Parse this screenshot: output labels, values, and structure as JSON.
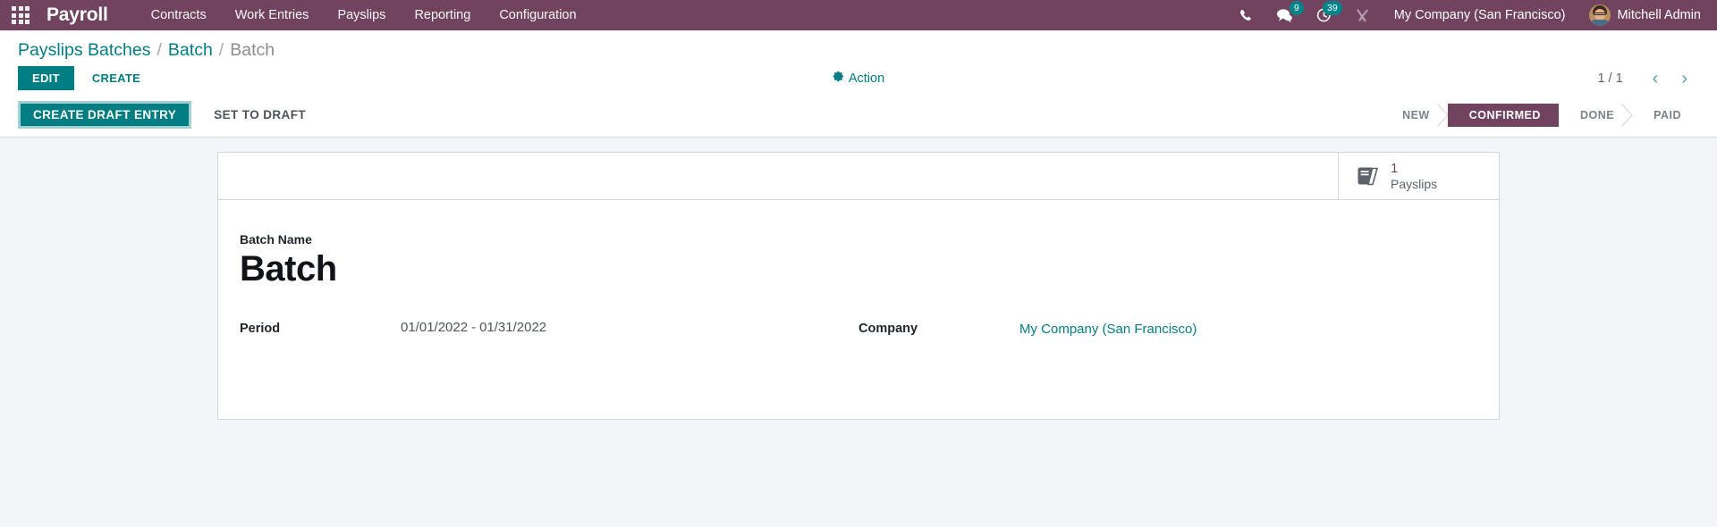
{
  "navbar": {
    "apps_icon": "apps-grid-icon",
    "brand": "Payroll",
    "menu": [
      {
        "label": "Contracts"
      },
      {
        "label": "Work Entries"
      },
      {
        "label": "Payslips"
      },
      {
        "label": "Reporting"
      },
      {
        "label": "Configuration"
      }
    ],
    "icons": {
      "phone": "phone-icon",
      "messages": "chat-bubble-icon",
      "messages_badge": "9",
      "activities": "clock-activity-icon",
      "activities_badge": "39",
      "tools": "wrench-screwdriver-icon"
    },
    "company": "My Company (San Francisco)",
    "user": "Mitchell Admin",
    "background_color": "#71435f",
    "badge_color": "#00848b"
  },
  "breadcrumb": {
    "root": "Payslips Batches",
    "parent": "Batch",
    "current": "Batch",
    "separator": "/"
  },
  "control_panel": {
    "edit_label": "EDIT",
    "create_label": "CREATE",
    "action_label": "Action",
    "action_icon": "gear-icon",
    "pager_value": "1 / 1",
    "prev_icon": "chevron-left-icon",
    "next_icon": "chevron-right-icon"
  },
  "statusbar": {
    "buttons": [
      {
        "label": "CREATE DRAFT ENTRY",
        "style": "primary"
      },
      {
        "label": "SET TO DRAFT",
        "style": "secondary"
      }
    ],
    "stages": [
      {
        "label": "NEW",
        "active": false
      },
      {
        "label": "CONFIRMED",
        "active": true
      },
      {
        "label": "DONE",
        "active": false
      },
      {
        "label": "PAID",
        "active": false
      }
    ],
    "active_color": "#71435f"
  },
  "smart_buttons": [
    {
      "icon": "book-icon",
      "count": "1",
      "label": "Payslips"
    }
  ],
  "form": {
    "name_label": "Batch Name",
    "name_value": "Batch",
    "period_label": "Period",
    "period_start": "01/01/2022",
    "period_separator": "-",
    "period_end": "01/31/2022",
    "company_label": "Company",
    "company_value": "My Company (San Francisco)"
  },
  "colors": {
    "primary": "#017e84",
    "brand_purple": "#71435f",
    "page_background": "#f4f5f8"
  }
}
